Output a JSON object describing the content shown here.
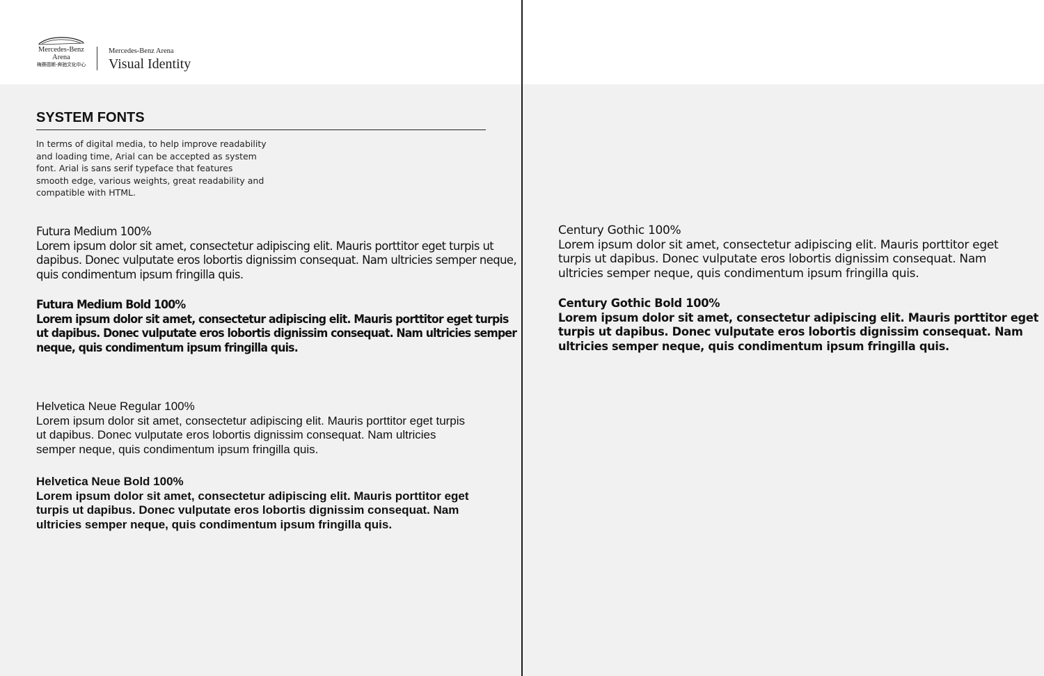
{
  "header": {
    "logo": {
      "line1": "Mercedes-Benz",
      "line2": "Arena",
      "line3": "梅赛德斯-奔驰文化中心"
    },
    "brand_small": "Mercedes-Benz Arena",
    "brand_large": "Visual Identity"
  },
  "section": {
    "title": "SYSTEM FONTS",
    "intro_lines": [
      "In terms of digital media, to help improve readability",
      "and loading time, Arial can be accepted as system",
      "font. Arial is sans serif typeface that features",
      "smooth  edge, various weights, great readability and",
      "compatible with HTML."
    ]
  },
  "samples": {
    "futura_medium": {
      "lines": [
        "Futura Medium 100%",
        "Lorem ipsum dolor sit amet, consectetur adipiscing elit. Mauris porttitor eget turpis ut",
        "dapibus. Donec vulputate eros lobortis dignissim consequat. Nam ultricies semper neque,",
        "quis condimentum ipsum fringilla quis."
      ]
    },
    "futura_bold": {
      "lines": [
        "Futura  Medium Bold 100%",
        "Lorem ipsum dolor sit amet, consectetur adipiscing elit. Mauris porttitor eget turpis",
        "ut dapibus. Donec vulputate eros lobortis dignissim consequat. Nam ultricies semper",
        "neque, quis condimentum ipsum fringilla quis."
      ]
    },
    "helvetica_regular": {
      "lines": [
        "Helvetica Neue Regular 100%",
        "Lorem ipsum dolor sit amet, consectetur adipiscing elit. Mauris porttitor eget turpis",
        "ut dapibus. Donec vulputate eros lobortis dignissim consequat. Nam ultricies",
        "semper neque, quis condimentum ipsum fringilla quis."
      ]
    },
    "helvetica_bold": {
      "lines": [
        "Helvetica Neue Bold 100%",
        "Lorem ipsum dolor sit amet, consectetur adipiscing elit. Mauris porttitor eget",
        "turpis ut dapibus. Donec vulputate eros lobortis dignissim consequat. Nam",
        "ultricies semper neque, quis condimentum ipsum fringilla quis."
      ]
    },
    "century_regular": {
      "lines": [
        "Century Gothic 100%",
        "Lorem ipsum dolor sit amet, consectetur adipiscing elit. Mauris porttitor eget",
        "turpis ut dapibus. Donec vulputate eros lobortis dignissim consequat. Nam",
        "ultricies semper neque, quis condimentum ipsum fringilla quis."
      ]
    },
    "century_bold": {
      "lines": [
        "Century Gothic Bold 100%",
        "Lorem ipsum dolor sit amet, consectetur adipiscing elit. Mauris porttitor eget",
        "turpis ut dapibus. Donec vulputate eros lobortis dignissim consequat. Nam",
        "ultricies semper neque, quis condimentum ipsum fringilla quis."
      ]
    }
  }
}
